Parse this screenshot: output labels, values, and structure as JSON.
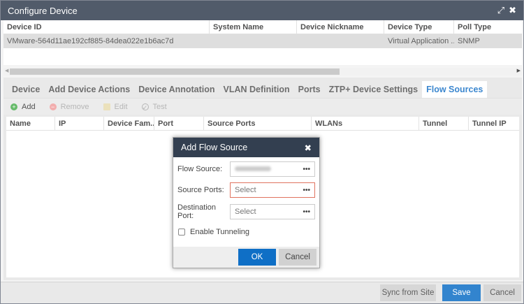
{
  "window": {
    "title": "Configure Device",
    "expand_icon": "expand-icon",
    "close_icon": "close-icon"
  },
  "device_table": {
    "columns": [
      "Device ID",
      "System Name",
      "Device Nickname",
      "Device Type",
      "Poll Type"
    ],
    "rows": [
      [
        "VMware-564d11ae192cf885-84dea022e1b6ac7d",
        "",
        "",
        "Virtual Application ...",
        "SNMP"
      ]
    ]
  },
  "tabs": [
    "Device",
    "Add Device Actions",
    "Device Annotation",
    "VLAN Definition",
    "Ports",
    "ZTP+ Device Settings",
    "Flow Sources"
  ],
  "active_tab": "Flow Sources",
  "toolbar": {
    "add": "Add",
    "remove": "Remove",
    "edit": "Edit",
    "test": "Test"
  },
  "flow_table": {
    "columns": [
      "Name",
      "IP",
      "Device Fam...",
      "Port",
      "Source Ports",
      "WLANs",
      "Tunnel",
      "Tunnel IP"
    ]
  },
  "footer": {
    "sync": "Sync from Site",
    "save": "Save",
    "cancel": "Cancel"
  },
  "dialog": {
    "title": "Add Flow Source",
    "fields": [
      {
        "label": "Flow Source:",
        "value": ""
      },
      {
        "label": "Source Ports:",
        "placeholder": "Select"
      },
      {
        "label": "Destination Port:",
        "placeholder": "Select"
      }
    ],
    "dots": "•••",
    "checkbox_label": "Enable Tunneling",
    "ok": "OK",
    "cancel": "Cancel"
  },
  "colors": {
    "titlebar": "#333f50",
    "accent": "#0f6fc6",
    "error_border": "#e0735f"
  }
}
